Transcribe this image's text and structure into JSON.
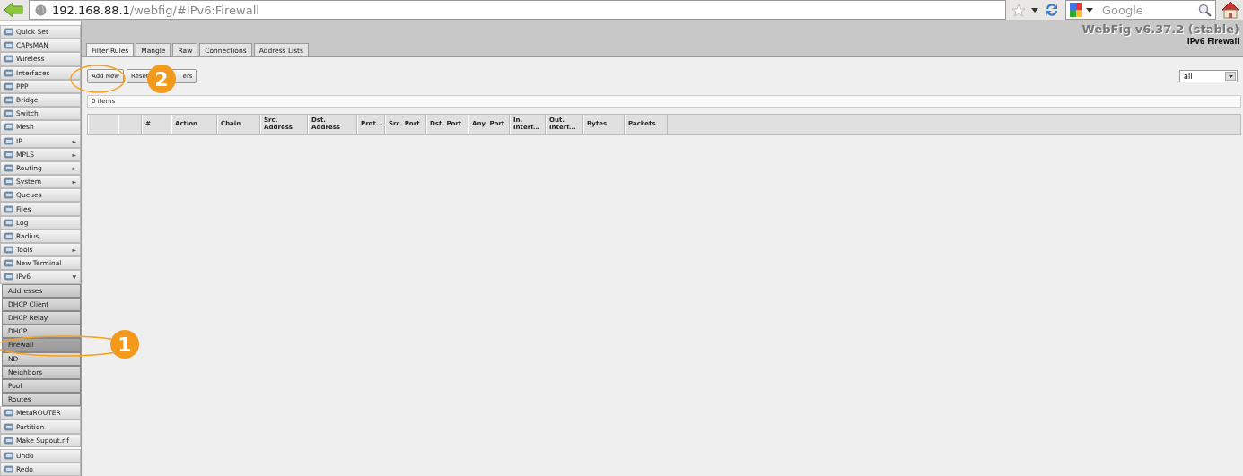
{
  "browser": {
    "url_host": "192.168.88.1",
    "url_path": "/webfig/#IPv6:Firewall",
    "search_placeholder": "Google"
  },
  "sidebar": {
    "items": [
      {
        "label": "Quick Set",
        "selected": false
      },
      {
        "label": "CAPsMAN",
        "selected": false
      },
      {
        "label": "Wireless",
        "selected": false
      },
      {
        "label": "Interfaces",
        "selected": false
      },
      {
        "label": "PPP",
        "selected": false
      },
      {
        "label": "Bridge",
        "selected": false
      },
      {
        "label": "Switch",
        "selected": false
      },
      {
        "label": "Mesh",
        "selected": false
      },
      {
        "label": "IP",
        "arrow": "►",
        "selected": false
      },
      {
        "label": "MPLS",
        "arrow": "►",
        "selected": false
      },
      {
        "label": "Routing",
        "arrow": "►",
        "selected": false
      },
      {
        "label": "System",
        "arrow": "►",
        "selected": false
      },
      {
        "label": "Queues",
        "selected": false
      },
      {
        "label": "Files",
        "selected": false
      },
      {
        "label": "Log",
        "selected": false
      },
      {
        "label": "Radius",
        "selected": false
      },
      {
        "label": "Tools",
        "arrow": "►",
        "selected": false
      },
      {
        "label": "New Terminal",
        "selected": false
      },
      {
        "label": "IPv6",
        "arrow": "▼",
        "selected": false,
        "expanded": true,
        "children": [
          {
            "label": "Addresses",
            "selected": false
          },
          {
            "label": "DHCP Client",
            "selected": false
          },
          {
            "label": "DHCP Relay",
            "selected": false
          },
          {
            "label": "DHCP",
            "selected": false
          },
          {
            "label": "Firewall",
            "selected": true
          },
          {
            "label": "ND",
            "selected": false
          },
          {
            "label": "Neighbors",
            "selected": false
          },
          {
            "label": "Pool",
            "selected": false
          },
          {
            "label": "Routes",
            "selected": false
          }
        ]
      },
      {
        "label": "MetaROUTER",
        "selected": false
      },
      {
        "label": "Partition",
        "selected": false
      },
      {
        "label": "Make Supout.rif",
        "selected": false
      },
      {
        "label": "Undo",
        "selected": false,
        "gap": true
      },
      {
        "label": "Redo",
        "selected": false
      }
    ]
  },
  "header": {
    "title": "WebFig v6.37.2 (stable)",
    "subtitle": "IPv6 Firewall"
  },
  "tabs": [
    {
      "label": "Filter Rules",
      "selected": true
    },
    {
      "label": "Mangle",
      "selected": false
    },
    {
      "label": "Raw",
      "selected": false
    },
    {
      "label": "Connections",
      "selected": false
    },
    {
      "label": "Address Lists",
      "selected": false
    }
  ],
  "buttons": [
    {
      "label": "Add New"
    },
    {
      "label": "Reset",
      "label_after": "ers"
    }
  ],
  "filter": {
    "value": "all"
  },
  "item_count": "0 items",
  "table": {
    "columns": [
      "",
      "",
      "#",
      "Action",
      "Chain",
      "Src. Address",
      "Dst. Address",
      "Prot...",
      "Src. Port",
      "Dst. Port",
      "Any. Port",
      "In. Interf...",
      "Out. Interf...",
      "Bytes",
      "Packets"
    ]
  },
  "annotations": [
    {
      "label": "1"
    },
    {
      "label": "2"
    }
  ]
}
